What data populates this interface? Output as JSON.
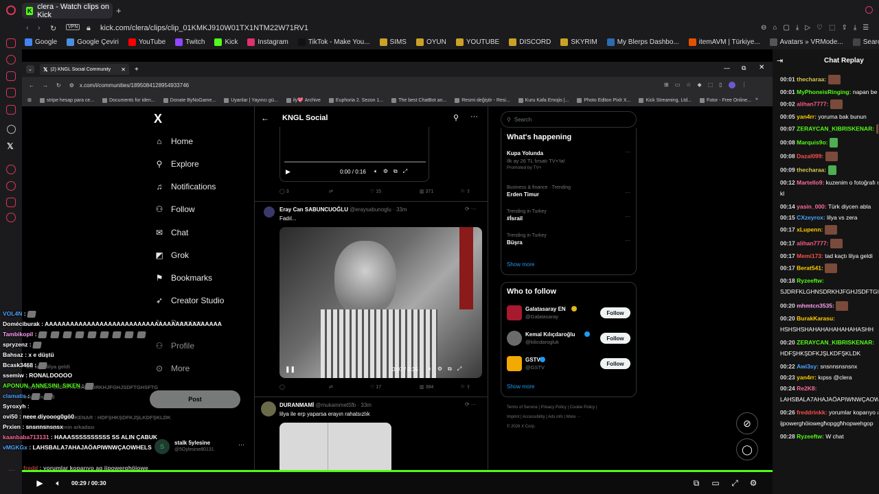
{
  "opera": {
    "tab_title": "clera - Watch clips on Kick",
    "tab_new": "+",
    "vpn": "VPN",
    "url": "kick.com/clera/clips/clip_01KMKJ910W01TX1NTM22W71RV1",
    "bookmarks": [
      "Google",
      "Google Çeviri",
      "YouTube",
      "Twitch",
      "Kick",
      "Instagram",
      "TikTok - Make You...",
      "SIMS",
      "OYUN",
      "YOUTUBE",
      "DISCORD",
      "SKYRIM",
      "My Blerps Dashbo...",
      "itemAVM | Türkiye...",
      "Avatars » VRMode...",
      "Search | RipperSt..."
    ],
    "bookmark_colors": [
      "#4285f4",
      "#4a90e2",
      "#ff0000",
      "#9146ff",
      "#53fc18",
      "#e1306c",
      "#111111",
      "#c9a227",
      "#c9a227",
      "#c9a227",
      "#c9a227",
      "#c9a227",
      "#2b6cb0",
      "#e65100",
      "#555555",
      "#444444"
    ]
  },
  "inner_window": {
    "tab_title": "(2) KNGL Social Community",
    "url": "x.com/i/communities/1895084128954933746",
    "bookmarks": [
      "stripe hesap para ce...",
      "Documents for iden...",
      "Donate ByNoGame...",
      "Uyarılar | Yayıncı gü...",
      "ily💖 Archive",
      "Euphoria 2. Sezon 1...",
      "The best ChatBot an...",
      "Resmi değiştir - Resi...",
      "Kuru Kafa Emojis |...",
      "Photo Editon Pixlr X...",
      "Kick Streaming, Ltd...",
      "Fotor - Free Online..."
    ]
  },
  "x": {
    "logo": "X",
    "nav": [
      "Home",
      "Explore",
      "Notifications",
      "Follow",
      "Chat",
      "Grok",
      "Bookmarks",
      "Creator Studio",
      "Premium",
      "Profile",
      "More"
    ],
    "post_button": "Post",
    "account_name": "stalk 5ylesine",
    "account_handle": "@5Oylesine80131",
    "header_title": "KNGL Social",
    "video1_time": "0:00 / 0:16",
    "post1_stats": {
      "replies": "3",
      "likes": "15",
      "views": "371"
    },
    "post2": {
      "name": "Eray Can SABUNCUOĞLU",
      "handle": "@eraysabunoglu · 33m",
      "text": "Fadıl...",
      "video_time": "0:07 / 0:35",
      "likes": "17",
      "views": "384"
    },
    "post3": {
      "name": "DURANMAMİ",
      "handle": "@mukammet5fb · 33m",
      "text": "lilya ile erp yaparsa erayın rahatsızlık"
    },
    "search_placeholder": "Search",
    "happening_title": "What's happening",
    "trends": [
      {
        "meta": "",
        "title": "Kupa Yolunda",
        "sub": "İlk ay 26 TL fırsatı TV+'ta!",
        "promo": "Promoted by TV+"
      },
      {
        "meta": "Business & finance · Trending",
        "title": "Erden Timur",
        "sub": "",
        "promo": ""
      },
      {
        "meta": "Trending in Turkey",
        "title": "#İsrail",
        "sub": "",
        "promo": ""
      },
      {
        "meta": "Trending in Turkey",
        "title": "Büşra",
        "sub": "",
        "promo": ""
      }
    ],
    "show_more": "Show more",
    "who_title": "Who to follow",
    "who": [
      {
        "name": "Galatasaray EN",
        "handle": "@Galatasaray",
        "color": "#a6192e"
      },
      {
        "name": "Kemal Kılıçdaroğlu",
        "handle": "@kilicdarogluk",
        "color": "#6b6b6b"
      },
      {
        "name": "GSTV",
        "handle": "@GSTV",
        "color": "#f2a900"
      }
    ],
    "follow_label": "Follow",
    "footer1": "Terms of Service  |  Privacy Policy  |  Cookie Policy  |",
    "footer2": "Imprint  |  Accessibility  |  Ads info  |  More ···",
    "footer3": "© 2026 X Corp."
  },
  "overlay_chat": [
    {
      "user": "VOL4N",
      "msg": "",
      "color": "#4fa3ff",
      "emotes": 1
    },
    {
      "user": "Doméciburak",
      "msg": "AAAAAAAAAAAAAAAAAAAAAAAAAAAAAAAAAAAAAAAAAA",
      "color": "#ffffff",
      "emotes": 0
    },
    {
      "user": "Tambikopil",
      "msg": "",
      "color": "#ff9ff3",
      "emotes": 9
    },
    {
      "user": "spryzenz",
      "msg": "",
      "color": "#ffffff",
      "emotes": 1
    },
    {
      "user": "Bahsaz",
      "msg": "x e düştü",
      "color": "#ffffff",
      "emotes": 0
    },
    {
      "user": "Bcask3468",
      "msg": "",
      "color": "#ffffff",
      "emotes": 1
    },
    {
      "user": "ssemiw",
      "msg": "RONALDOOOO",
      "color": "#ffffff",
      "emotes": 0
    },
    {
      "user": "APONUN_ANNESINI_SIKEN",
      "msg": "",
      "color": "#53fc18",
      "emotes": 1
    },
    {
      "user": "clamatis",
      "msg": "",
      "color": "#4fa3ff",
      "emotes": 2
    },
    {
      "user": "Syroxyh",
      "msg": "",
      "color": "#ffffff",
      "emotes": 0
    },
    {
      "user": "ovi50",
      "msg": "neee diyooog0gö0",
      "color": "#ffffff",
      "emotes": 0
    },
    {
      "user": "Prxien",
      "msg": "snsnnsnsnsx",
      "color": "#ffffff",
      "emotes": 0
    },
    {
      "user": "kaanbaba713131",
      "msg": "HAAASSSSSSSSSS SS ALIN ÇABUK",
      "color": "#ff6b9d",
      "emotes": 0
    },
    {
      "user": "vMGKGx",
      "msg": "LAHSBALA7AHAJAÖAPIWNWÇAOWHELS",
      "color": "#4fa3ff",
      "emotes": 0
    },
    {
      "user": "fredd",
      "msg": "yorumlar koparıyo ag ijpowerghöiowe",
      "color": "#ff4d4d",
      "emotes": 0
    },
    {
      "user": "Ryzeeftw",
      "msg": "W chat",
      "color": "#53fc18",
      "emotes": 0
    }
  ],
  "overlay_ghost": [
    "kxl laçtı lilya geldi",
    "Ryzeeftw : SJDRFKLGHNSDRKHJFGHJSDFTGHSFTG",
    "mhmtcn3535",
    "ZERAYCAN_KIBRISKENAR : HDFŞHKŞDFKJŞLKDFŞKLDK",
    "Dazal099 : gecenin arkadası"
  ],
  "player": {
    "time": "00:29 / 00:30"
  },
  "chat_replay": {
    "title": "Chat Replay",
    "messages": [
      {
        "time": "00:01",
        "user": "thecharaa:",
        "msg": "",
        "color": "#d9c84f",
        "emote": "brown"
      },
      {
        "time": "00:01",
        "user": "MyPhoneisRinging:",
        "msg": "napan be gi",
        "color": "#53fc18",
        "emote": ""
      },
      {
        "time": "00:02",
        "user": "alihan7777:",
        "msg": "",
        "color": "#ff5c8a",
        "emote": "brown"
      },
      {
        "time": "00:05",
        "user": "yan4rr:",
        "msg": "yoruma bak bunun",
        "color": "#ffcc00",
        "emote": ""
      },
      {
        "time": "00:07",
        "user": "ZERAYCAN_KIBRISKENAR:",
        "msg": "",
        "color": "#53fc18",
        "emote": "brown"
      },
      {
        "time": "00:08",
        "user": "Marquis9o:",
        "msg": "",
        "color": "#53fc18",
        "emote": "green"
      },
      {
        "time": "00:08",
        "user": "Dazal099:",
        "msg": "",
        "color": "#ff4d4d",
        "emote": "brown"
      },
      {
        "time": "00:09",
        "user": "thecharaa:",
        "msg": "",
        "color": "#d9c84f",
        "emote": "green"
      },
      {
        "time": "00:12",
        "user": "Martello9:",
        "msg": "kuzenim o fotoğrafı r",
        "color": "#ff6b9d",
        "emote": ""
      },
      {
        "time": "",
        "user": "",
        "msg": "kl",
        "color": "#ffffff",
        "emote": ""
      },
      {
        "time": "00:14",
        "user": "yasin_000:",
        "msg": "Türk diycen abla",
        "color": "#ff6b9d",
        "emote": ""
      },
      {
        "time": "00:15",
        "user": "CXzeyrox:",
        "msg": "lilya vs zera",
        "color": "#4fa3ff",
        "emote": ""
      },
      {
        "time": "00:17",
        "user": "xLupenn:",
        "msg": "",
        "color": "#ffcc00",
        "emote": "brown"
      },
      {
        "time": "00:17",
        "user": "alihan7777:",
        "msg": "",
        "color": "#ff5c8a",
        "emote": "brown"
      },
      {
        "time": "00:17",
        "user": "Memi173:",
        "msg": "tad kaçtı lilya geldi",
        "color": "#ff4d4d",
        "emote": ""
      },
      {
        "time": "00:17",
        "user": "Berat541:",
        "msg": "",
        "color": "#ffcc00",
        "emote": "brown"
      },
      {
        "time": "00:18",
        "user": "Ryzeeftw:",
        "msg": "",
        "color": "#53fc18",
        "emote": ""
      },
      {
        "time": "",
        "user": "",
        "msg": "SJDRFKLGHNSDRKHJFGHJSDFTGHS",
        "color": "#ffffff",
        "emote": ""
      },
      {
        "time": "00:20",
        "user": "mhmtcn3535:",
        "msg": "",
        "color": "#ff9ff3",
        "emote": "brown"
      },
      {
        "time": "00:20",
        "user": "BurakKarasu:",
        "msg": "",
        "color": "#ffcc00",
        "emote": ""
      },
      {
        "time": "",
        "user": "",
        "msg": "HSHSHSHAHAHAHAHAHAHASHH",
        "color": "#ffffff",
        "emote": ""
      },
      {
        "time": "00:20",
        "user": "ZERAYCAN_KIBRISKENAR:",
        "msg": "",
        "color": "#53fc18",
        "emote": ""
      },
      {
        "time": "",
        "user": "",
        "msg": "HDFŞHKŞDFKJŞLKDFŞKLDK",
        "color": "#ffffff",
        "emote": ""
      },
      {
        "time": "00:22",
        "user": "Awi3sy:",
        "msg": "snsnnsnsnsnx",
        "color": "#4fa3ff",
        "emote": ""
      },
      {
        "time": "00:23",
        "user": "yan4rr:",
        "msg": "kıpss @clera",
        "color": "#ffcc00",
        "emote": ""
      },
      {
        "time": "00:24",
        "user": "Re2K8:",
        "msg": "",
        "color": "#ff6b9d",
        "emote": ""
      },
      {
        "time": "",
        "user": "",
        "msg": "LAHSBALA7AHAJAÖAPIWNWÇAOWH",
        "color": "#ffffff",
        "emote": ""
      },
      {
        "time": "00:26",
        "user": "freddrinkk:",
        "msg": "yorumlar koparıyo a",
        "color": "#ff4d4d",
        "emote": ""
      },
      {
        "time": "",
        "user": "",
        "msg": "ijpowerghöiowegħopggħhopwehgop",
        "color": "#ffffff",
        "emote": ""
      },
      {
        "time": "00:28",
        "user": "Ryzeeftw:",
        "msg": "W chat",
        "color": "#53fc18",
        "emote": ""
      }
    ]
  }
}
